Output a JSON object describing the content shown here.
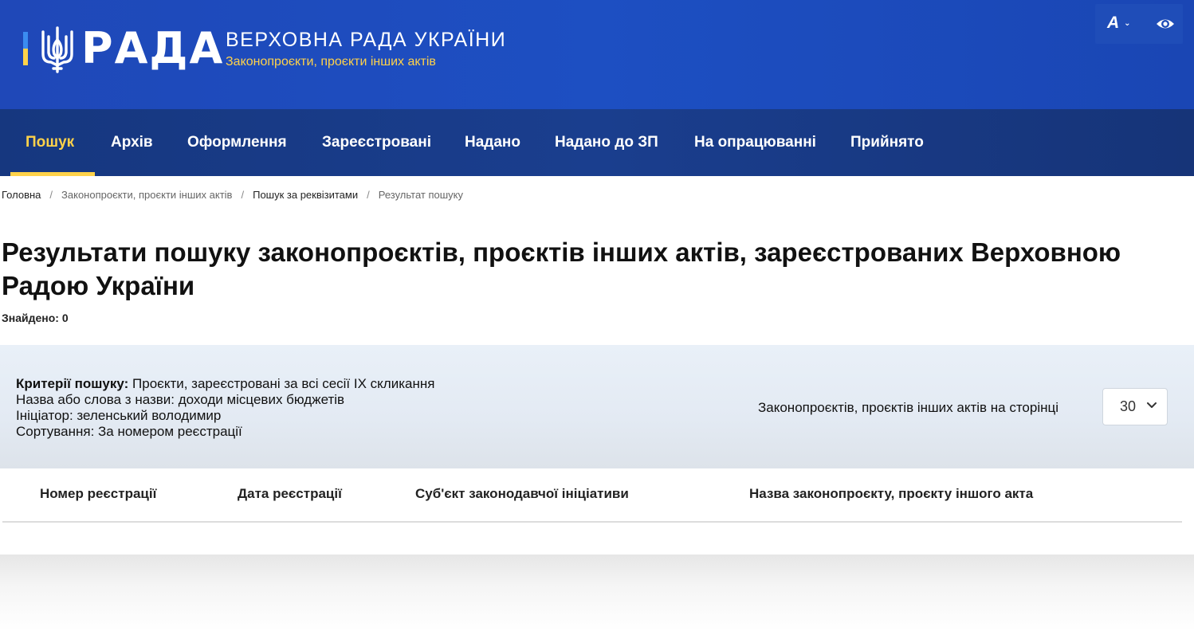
{
  "header": {
    "logo_word": "РАДА",
    "parliament_name": "ВЕРХОВНА РАДА УКРАЇНИ",
    "subtitle": "Законопроєкти, проєкти інших актів",
    "font_toggle_label": "A",
    "icons": [
      "trident-icon",
      "chevron-down-icon",
      "eye-icon"
    ]
  },
  "nav": {
    "items": [
      {
        "label": "Пошук",
        "active": true
      },
      {
        "label": "Архів"
      },
      {
        "label": "Оформлення"
      },
      {
        "label": "Зареєстровані"
      },
      {
        "label": "Надано"
      },
      {
        "label": "Надано до ЗП"
      },
      {
        "label": "На опрацюванні"
      },
      {
        "label": "Прийнято"
      }
    ]
  },
  "breadcrumb": [
    {
      "label": "Головна"
    },
    {
      "label": "Законопроєкти, проєкти інших актів"
    },
    {
      "label": "Пошук за реквізитами"
    },
    {
      "label": "Результат пошуку"
    }
  ],
  "page": {
    "title": "Результати пошуку законопроєктів, проєктів інших актів, зареєстрованих Верховною Радою України",
    "found_label": "Знайдено: 0"
  },
  "criteria": {
    "label": "Критерії пошуку:",
    "scope": "Проєкти, зареєстровані за всі сесії IX скликання",
    "name_line": "Назва або слова з назви: доходи місцевих бюджетів",
    "initiator_line": "Ініціатор: зеленський володимир",
    "sort_line": "Сортування: За номером реєстрації"
  },
  "per_page": {
    "label": "Законопроєктів, проєктів інших актів на сторінці",
    "value": "30"
  },
  "table": {
    "columns": [
      "Номер реєстрації",
      "Дата реєстрації",
      "Суб'єкт законодавчої ініціативи",
      "Назва законопроєкту, проєкту іншого акта"
    ]
  },
  "colors": {
    "header_blue": "#1f48b8",
    "nav_blue": "#16377f",
    "accent_yellow": "#ffd24a",
    "criteria_bg": "#e9f0f8"
  }
}
